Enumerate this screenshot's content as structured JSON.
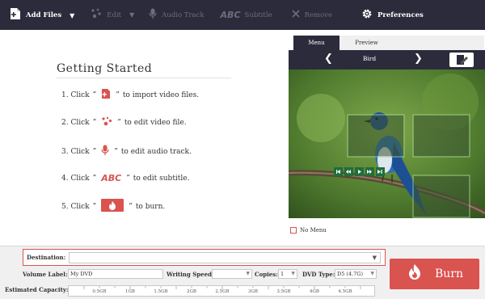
{
  "toolbar": {
    "add_files": "Add Files",
    "edit": "Edit",
    "audio_track": "Audio Track",
    "subtitle_logo": "ABC",
    "subtitle": "Subtitle",
    "remove": "Remove",
    "preferences": "Preferences"
  },
  "getting_started": {
    "title": "Getting Started",
    "steps": [
      {
        "num": "1. Click",
        "open": "”",
        "close": "”",
        "text": "to import video files.",
        "icon": "add-file-icon"
      },
      {
        "num": "2. Click",
        "open": "”",
        "close": "”",
        "text": "to edit video file.",
        "icon": "edit-effects-icon"
      },
      {
        "num": "3. Click",
        "open": "”",
        "close": "”",
        "text": "to edit audio track.",
        "icon": "microphone-icon"
      },
      {
        "num": "4. Click",
        "open": "”",
        "close": "”",
        "text": "to edit subtitle.",
        "icon": "abc-subtitle-icon",
        "icon_text": "ABC"
      },
      {
        "num": "5. Click",
        "open": "”",
        "close": "”",
        "text": "to burn.",
        "icon": "burn-flame-icon"
      }
    ]
  },
  "preview": {
    "tabs": [
      "Menu",
      "Preview"
    ],
    "active_tab": "Menu",
    "menu_title": "Bird",
    "no_menu_label": "No Menu",
    "no_menu_checked": false
  },
  "bottom": {
    "destination_label": "Destination:",
    "destination_value": "",
    "volume_label": "Volume Label:",
    "volume_value": "My DVD",
    "writing_speed_label": "Writing Speed:",
    "writing_speed_value": "",
    "copies_label": "Copies:",
    "copies_value": "1",
    "dvd_type_label": "DVD Type:",
    "dvd_type_value": "D5 (4.7G)",
    "capacity_label": "Estimated Capacity:",
    "capacity_ticks": [
      "0.5GB",
      "1GB",
      "1.5GB",
      "2GB",
      "2.5GB",
      "3GB",
      "3.5GB",
      "4GB",
      "4.5GB"
    ],
    "burn_label": "Burn"
  },
  "colors": {
    "toolbar_bg": "#2b2b3c",
    "accent_red": "#d9534f"
  }
}
